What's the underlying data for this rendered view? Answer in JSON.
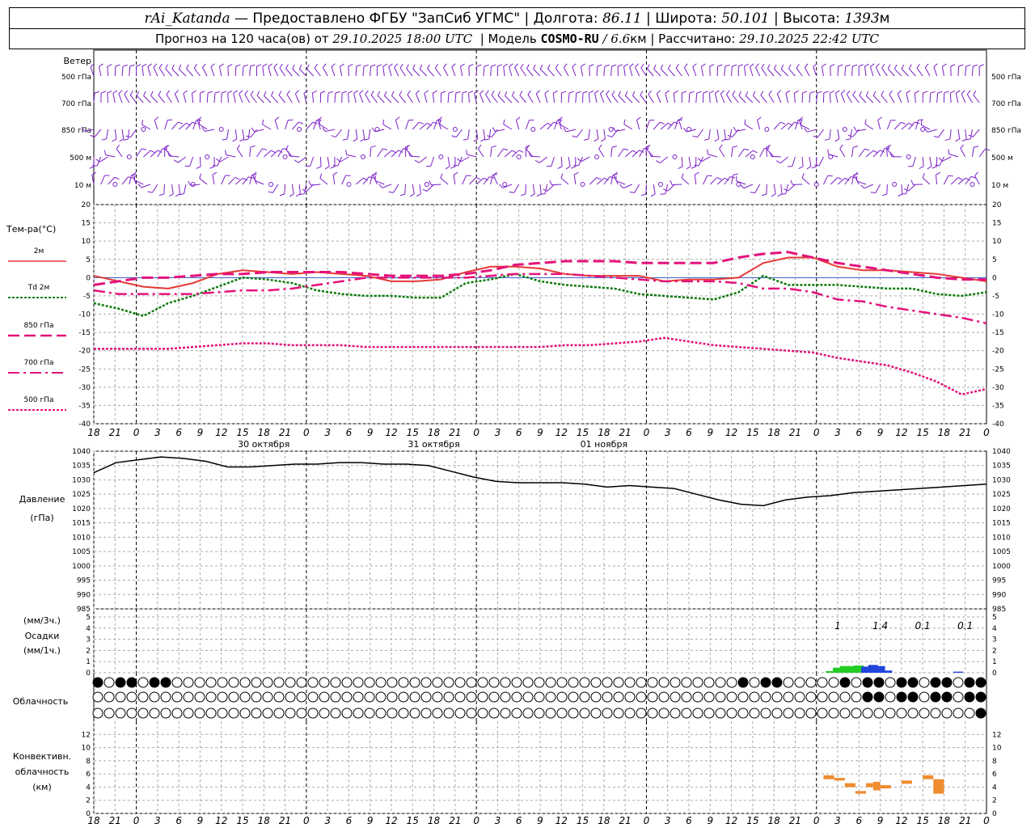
{
  "header": {
    "station": "rAi_Katanda",
    "provider": "— Предоставлено ФГБУ \"ЗапСиб УГМС\"",
    "lon_label": "Долгота:",
    "lon_value": "86.11",
    "lat_label": "Широта:",
    "lat_value": "50.101",
    "alt_label": "Высота:",
    "alt_value": "1393",
    "alt_unit": "м",
    "forecast_prefix": "Прогноз на 120 часа(ов) от",
    "forecast_start": "29.10.2025 18:00 UTC",
    "model_label": "Модель",
    "model_name": "COSMO-RU",
    "model_res": "/ 6.6",
    "model_res_unit": "км",
    "calc_label": "Рассчитано:",
    "calc_time": "29.10.2025 22:42 UTC"
  },
  "colors": {
    "wind": "#7b1fc8",
    "t2m": "#e53935",
    "td2m": "#0a7a0a",
    "t850": "#e4127a",
    "t700": "#e4127a",
    "t500": "#e4127a",
    "pressure": "#000000",
    "precip_rain": "#22cc22",
    "precip_heavy": "#2244dd",
    "convective": "#f08c30",
    "grid": "#aaaaaa"
  },
  "chart_data": [
    {
      "type": "wind_barbs",
      "title": "Ветер",
      "levels": [
        "500 гПа",
        "700 гПа",
        "850 гПа",
        "500 м",
        "10 м"
      ],
      "note": "wind barbs every hour across 120 h at 5 levels"
    },
    {
      "type": "line",
      "ylabel": "Тем-ра(°C)",
      "ylim": [
        -40,
        20
      ],
      "yticks": [
        20,
        15,
        10,
        5,
        0,
        -5,
        -10,
        -15,
        -20,
        -25,
        -30,
        -35,
        -40
      ],
      "x_hours": [
        0,
        3,
        6,
        9,
        12,
        15,
        18,
        21,
        24,
        27,
        30,
        33,
        36,
        39,
        42,
        45,
        48,
        51,
        54,
        57,
        60,
        63,
        66,
        69,
        72,
        75,
        78,
        81,
        84,
        87,
        90,
        93,
        96,
        99,
        102,
        105,
        108,
        111,
        114,
        117,
        120
      ],
      "series": [
        {
          "name": "2м",
          "style": "solid",
          "values": [
            0.5,
            -1.0,
            -2.5,
            -3.0,
            -1.5,
            1.0,
            2.0,
            1.5,
            1.0,
            1.5,
            1.0,
            0.5,
            -1.0,
            -1.0,
            -0.5,
            1.5,
            3.0,
            3.0,
            2.5,
            1.0,
            0.5,
            0.5,
            0.5,
            -1.0,
            -0.5,
            -0.5,
            0.0,
            4.0,
            5.5,
            5.5,
            3.0,
            2.0,
            2.0,
            1.5,
            1.0,
            0.0,
            -1.0
          ]
        },
        {
          "name": "Td 2м",
          "style": "dotted",
          "values": [
            -7.0,
            -8.5,
            -10.5,
            -7.0,
            -5.0,
            -2.5,
            0.0,
            -0.5,
            -1.5,
            -3.5,
            -4.5,
            -5.0,
            -5.0,
            -5.5,
            -5.5,
            -1.5,
            -0.5,
            1.0,
            -1.0,
            -2.0,
            -2.5,
            -3.0,
            -4.5,
            -5.0,
            -5.5,
            -6.0,
            -4.0,
            0.5,
            -2.0,
            -2.0,
            -2.0,
            -2.5,
            -3.0,
            -3.0,
            -4.5,
            -5.0,
            -4.0
          ]
        },
        {
          "name": "850 гПа",
          "style": "dashed",
          "values": [
            -2.0,
            -1.0,
            0.0,
            0.0,
            0.5,
            1.0,
            1.0,
            1.5,
            1.5,
            1.5,
            1.5,
            1.0,
            0.5,
            0.5,
            0.5,
            1.0,
            2.0,
            3.5,
            4.0,
            4.5,
            4.5,
            4.5,
            4.0,
            4.0,
            4.0,
            4.0,
            5.5,
            6.5,
            7.0,
            5.5,
            4.0,
            3.0,
            2.0,
            1.0,
            0.0,
            -0.5,
            -0.5
          ]
        },
        {
          "name": "700 гПа",
          "style": "dashdot",
          "values": [
            -3.5,
            -4.5,
            -4.5,
            -4.5,
            -4.5,
            -4.0,
            -3.5,
            -3.5,
            -3.0,
            -2.0,
            -1.0,
            0.0,
            0.0,
            0.0,
            0.0,
            0.0,
            0.5,
            1.0,
            1.0,
            1.0,
            0.5,
            0.0,
            -0.5,
            -1.0,
            -1.0,
            -1.0,
            -1.5,
            -3.0,
            -3.0,
            -4.0,
            -6.0,
            -6.5,
            -8.0,
            -9.0,
            -10.0,
            -11.0,
            -12.5
          ]
        },
        {
          "name": "500 гПа",
          "style": "dotted",
          "values": [
            -19.5,
            -19.5,
            -19.5,
            -19.5,
            -19.0,
            -18.5,
            -18.0,
            -18.0,
            -18.5,
            -18.5,
            -18.5,
            -19.0,
            -19.0,
            -19.0,
            -19.0,
            -19.0,
            -19.0,
            -19.0,
            -19.0,
            -18.5,
            -18.5,
            -18.0,
            -17.5,
            -16.5,
            -17.5,
            -18.5,
            -19.0,
            -19.5,
            -20.0,
            -20.5,
            -22.0,
            -23.0,
            -24.0,
            -26.0,
            -28.5,
            -32.0,
            -30.5
          ]
        }
      ]
    },
    {
      "type": "line",
      "ylabel": "Давление",
      "yunit": "(гПа)",
      "ylim": [
        985,
        1040
      ],
      "yticks": [
        1040,
        1035,
        1030,
        1025,
        1020,
        1015,
        1010,
        1005,
        1000,
        995,
        990,
        985
      ],
      "x_hours": [
        0,
        3,
        6,
        9,
        12,
        15,
        18,
        21,
        24,
        27,
        30,
        33,
        36,
        39,
        42,
        45,
        48,
        51,
        54,
        57,
        60,
        63,
        66,
        69,
        72,
        75,
        78,
        81,
        84,
        87,
        90,
        93,
        96,
        99,
        102,
        105,
        108,
        111,
        114,
        117,
        120
      ],
      "series": [
        {
          "name": "Давление",
          "values": [
            1032.5,
            1036.0,
            1037.0,
            1038.0,
            1037.5,
            1036.5,
            1034.5,
            1034.5,
            1035.0,
            1035.5,
            1035.5,
            1036.0,
            1036.0,
            1035.5,
            1035.5,
            1035.0,
            1033.0,
            1031.0,
            1029.5,
            1029.0,
            1029.0,
            1029.0,
            1028.5,
            1027.5,
            1028.0,
            1027.5,
            1027.0,
            1025.0,
            1023.0,
            1021.5,
            1021.0,
            1023.0,
            1024.0,
            1024.5,
            1025.5,
            1026.0,
            1026.5,
            1027.0,
            1027.5,
            1028.0,
            1028.5
          ]
        }
      ]
    },
    {
      "type": "bar",
      "ylabel1": "(мм/3ч.)",
      "ylabel2": "Осадки",
      "ylabel3": "(мм/1ч.)",
      "ylim": [
        0,
        5
      ],
      "yticks": [
        5,
        4,
        3,
        2,
        1,
        0
      ],
      "totals": [
        {
          "hour": 99,
          "label": "1"
        },
        {
          "hour": 105,
          "label": "1.4"
        },
        {
          "hour": 111,
          "label": "0.1"
        },
        {
          "hour": 117,
          "label": "0.1"
        }
      ],
      "bars": [
        {
          "hour": 98,
          "value": 0.15,
          "kind": "rain"
        },
        {
          "hour": 99,
          "value": 0.45,
          "kind": "rain"
        },
        {
          "hour": 100,
          "value": 0.6,
          "kind": "rain"
        },
        {
          "hour": 101,
          "value": 0.6,
          "kind": "rain"
        },
        {
          "hour": 102,
          "value": 0.65,
          "kind": "rain"
        },
        {
          "hour": 103,
          "value": 0.55,
          "kind": "heavy"
        },
        {
          "hour": 104,
          "value": 0.7,
          "kind": "heavy"
        },
        {
          "hour": 105,
          "value": 0.6,
          "kind": "heavy"
        },
        {
          "hour": 106,
          "value": 0.2,
          "kind": "heavy"
        },
        {
          "hour": 116,
          "value": 0.1,
          "kind": "heavy"
        }
      ]
    },
    {
      "type": "cloud_cover",
      "ylabel": "Облачность",
      "rows": 3,
      "note": "cloud cover symbols (circles filled in octas) per hour at 3 levels"
    },
    {
      "type": "bar",
      "ylabel1": "Конвективн.",
      "ylabel2": "облачность",
      "ylabel3": "(км)",
      "ylim": [
        0,
        14
      ],
      "yticks": [
        12,
        10,
        8,
        6,
        4,
        2,
        0
      ],
      "segments": [
        {
          "hour_from": 97,
          "hour_to": 98.5,
          "base": 5.2,
          "top": 5.8
        },
        {
          "hour_from": 98.5,
          "hour_to": 100,
          "base": 5.0,
          "top": 5.4
        },
        {
          "hour_from": 100,
          "hour_to": 101.5,
          "base": 4.0,
          "top": 4.6
        },
        {
          "hour_from": 101.5,
          "hour_to": 103,
          "base": 3.0,
          "top": 3.4
        },
        {
          "hour_from": 103,
          "hour_to": 104,
          "base": 4.0,
          "top": 4.6
        },
        {
          "hour_from": 104,
          "hour_to": 105,
          "base": 3.5,
          "top": 4.8
        },
        {
          "hour_from": 105,
          "hour_to": 106.5,
          "base": 3.8,
          "top": 4.3
        },
        {
          "hour_from": 108,
          "hour_to": 109.5,
          "base": 4.5,
          "top": 5.0
        },
        {
          "hour_from": 111,
          "hour_to": 112.5,
          "base": 5.2,
          "top": 5.8
        },
        {
          "hour_from": 112.5,
          "hour_to": 114,
          "base": 3.0,
          "top": 5.2
        }
      ]
    }
  ],
  "time_axis": {
    "hour_labels": [
      "18",
      "21",
      "0",
      "3",
      "6",
      "9",
      "12",
      "15",
      "18",
      "21",
      "0",
      "3",
      "6",
      "9",
      "12",
      "15",
      "18",
      "21",
      "0",
      "3",
      "6",
      "9",
      "12",
      "15",
      "18",
      "21",
      "0",
      "3",
      "6",
      "9",
      "12",
      "15",
      "18",
      "21",
      "0",
      "3",
      "6",
      "9",
      "12",
      "15",
      "18",
      "21",
      "0"
    ],
    "dates": [
      {
        "hour": 18,
        "label": "30 октября"
      },
      {
        "hour": 42,
        "label": "31 октября"
      },
      {
        "hour": 66,
        "label": "01 ноября"
      }
    ]
  },
  "legend": {
    "t2m": "2м",
    "td_prefix": "Td",
    "td_suffix": "2м",
    "t850": "850 гПа",
    "t700": "700 гПа",
    "t500": "500 гПа"
  }
}
